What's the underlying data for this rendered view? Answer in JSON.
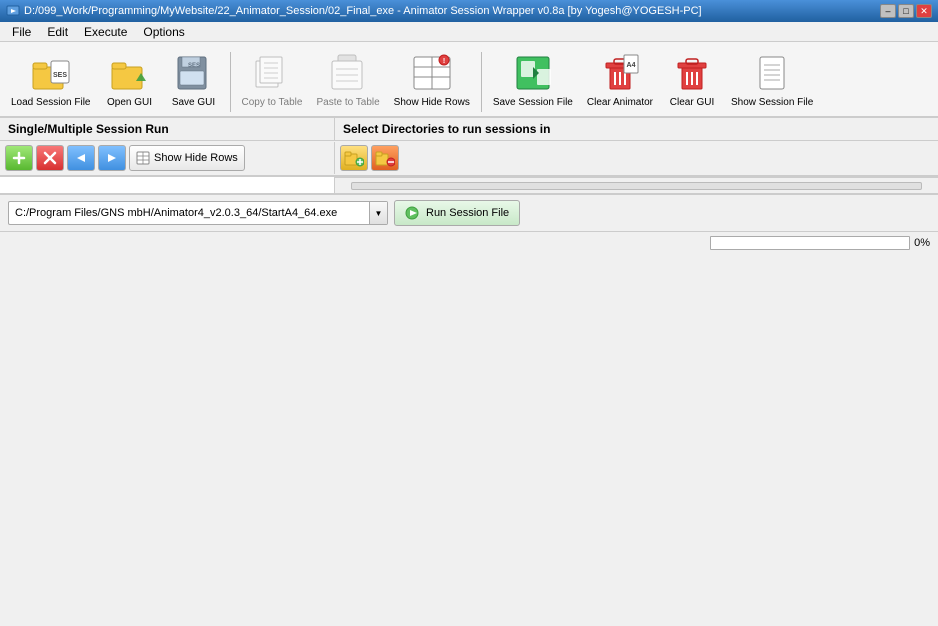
{
  "titleBar": {
    "icon": "🎬",
    "text": "D:/099_Work/Programming/MyWebsite/22_Animator_Session/02_Final_exe - Animator Session Wrapper v0.8a [by Yogesh@YOGESH-PC]",
    "minimizeLabel": "–",
    "maximizeLabel": "□",
    "closeLabel": "✕"
  },
  "menuBar": {
    "items": [
      "File",
      "Edit",
      "Execute",
      "Options"
    ]
  },
  "toolbar": {
    "buttons": [
      {
        "id": "load-session",
        "label": "Load Session File",
        "icon": "folder-ses"
      },
      {
        "id": "open-gui",
        "label": "Open GUI",
        "icon": "folder-open"
      },
      {
        "id": "save-gui",
        "label": "Save GUI",
        "icon": "save-ses"
      },
      {
        "id": "copy-table",
        "label": "Copy to Table",
        "icon": "copy-table",
        "disabled": true
      },
      {
        "id": "paste-table",
        "label": "Paste to Table",
        "icon": "paste-table",
        "disabled": true
      },
      {
        "id": "show-hide-rows-toolbar",
        "label": "Show Hide Rows",
        "icon": "show-hide"
      },
      {
        "id": "save-session",
        "label": "Save Session File",
        "icon": "save-session"
      },
      {
        "id": "clear-animator",
        "label": "Clear Animator",
        "icon": "clear-animator"
      },
      {
        "id": "clear-gui",
        "label": "Clear GUI",
        "icon": "clear-gui"
      },
      {
        "id": "show-session",
        "label": "Show Session File",
        "icon": "show-session"
      }
    ]
  },
  "leftSection": {
    "header": "Single/Multiple Session Run",
    "addLabel": "+",
    "removeLabel": "✕",
    "backLabel": "◀",
    "forwardLabel": "▶",
    "showHideLabel": "Show Hide Rows"
  },
  "rightSection": {
    "header": "Select Directories to run sessions in",
    "addFolderLabel": "📁+",
    "removeFolderLabel": "✕"
  },
  "bottomBar": {
    "exePath": "C:/Program Files/GNS mbH/Animator4_v2.0.3_64/StartA4_64.exe",
    "dropdownArrow": "▼",
    "runLabel": "Run Session File",
    "runIcon": "▶"
  },
  "statusBar": {
    "progressValue": 0,
    "progressMax": 100,
    "progressLabel": "0%"
  }
}
